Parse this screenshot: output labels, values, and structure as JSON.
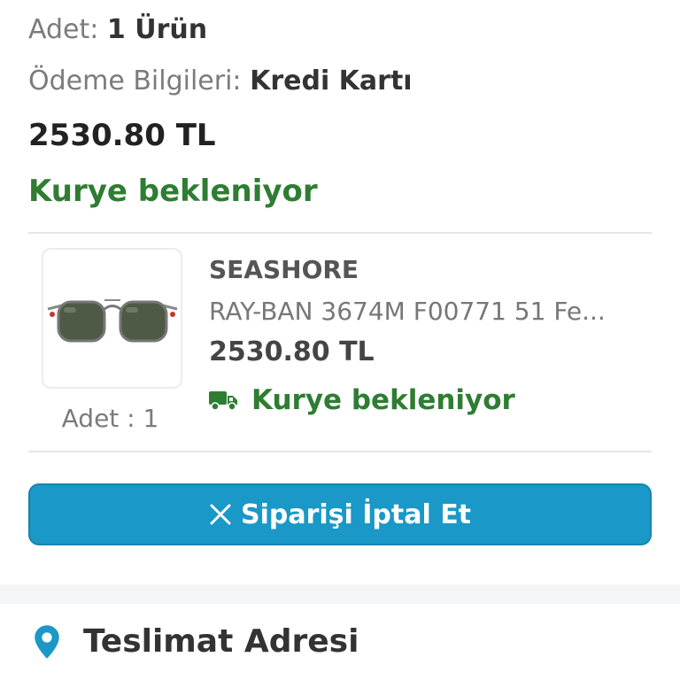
{
  "order_summary": {
    "quantity_label": "Adet:",
    "quantity_value": "1 Ürün",
    "payment_label": "Ödeme Bilgileri:",
    "payment_value": "Kredi Kartı",
    "total": "2530.80 TL",
    "status": "Kurye bekleniyor"
  },
  "product": {
    "brand": "SEASHORE",
    "name": "RAY-BAN 3674M F00771 51 Fe...",
    "price": "2530.80 TL",
    "status": "Kurye bekleniyor",
    "quantity_text": "Adet : 1",
    "status_icon": "truck-icon",
    "image_icon": "sunglasses-image"
  },
  "cancel_button": {
    "label": "Siparişi İptal Et",
    "icon": "close-icon"
  },
  "delivery_address": {
    "title": "Teslimat Adresi",
    "icon": "location-pin-icon"
  },
  "colors": {
    "status_green": "#2e7d32",
    "button_blue": "#1a98c7",
    "pin_blue": "#1a98c7"
  }
}
